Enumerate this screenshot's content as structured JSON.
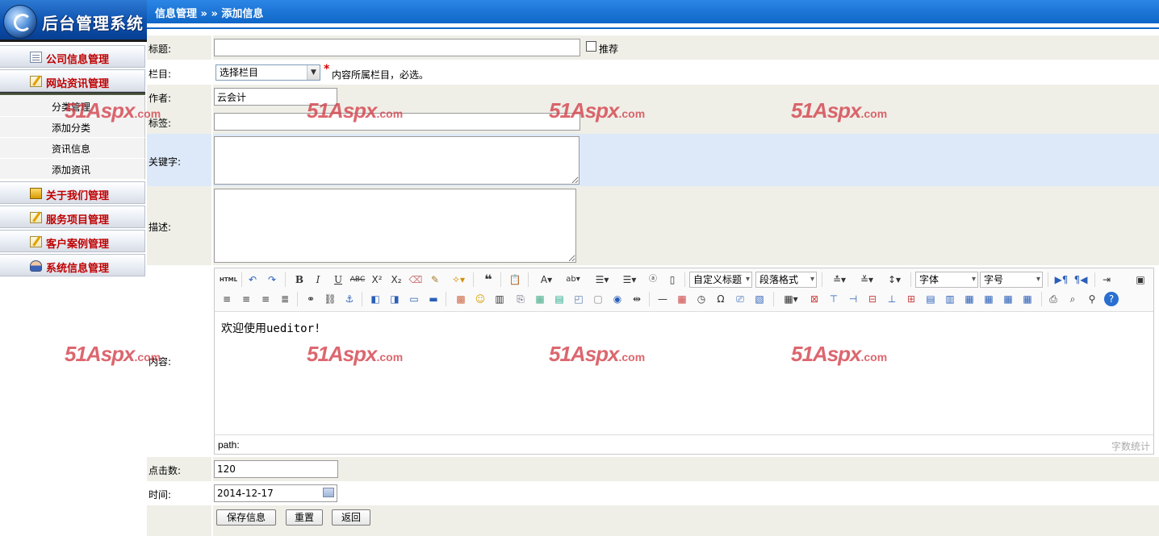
{
  "app": {
    "title": "后台管理系统",
    "breadcrumb": "信息管理 » » 添加信息"
  },
  "sidebar": {
    "menus": [
      {
        "label": "公司信息管理",
        "icon": "document-icon"
      },
      {
        "label": "网站资讯管理",
        "icon": "pencil-document-icon"
      },
      {
        "label": "关于我们管理",
        "icon": "box-icon"
      },
      {
        "label": "服务项目管理",
        "icon": "pencil-document-icon"
      },
      {
        "label": "客户案例管理",
        "icon": "pencil-document-icon"
      },
      {
        "label": "系统信息管理",
        "icon": "user-icon"
      }
    ],
    "submenu": [
      "分类管理",
      "添加分类",
      "资讯信息",
      "添加资讯"
    ]
  },
  "form": {
    "title_label": "标题:",
    "title_value": "",
    "recommend_label": "推荐",
    "column_label": "栏目:",
    "column_value": "选择栏目",
    "column_required": "*",
    "column_hint": "内容所属栏目，必选。",
    "author_label": "作者:",
    "author_value": "云会计",
    "tags_label": "标签:",
    "tags_value": "",
    "keywords_label": "关键字:",
    "keywords_value": "",
    "description_label": "描述:",
    "description_value": "",
    "content_label": "内容:",
    "clicks_label": "点击数:",
    "clicks_value": "120",
    "time_label": "时间:",
    "time_value": "2014-12-17"
  },
  "editor": {
    "content": "欢迎使用ueditor!",
    "path_label": "path:",
    "word_count": "字数统计",
    "selects": {
      "custom_title": "自定义标题",
      "paragraph": "段落格式",
      "font": "字体",
      "font_size": "字号"
    }
  },
  "buttons": {
    "save": "保存信息",
    "reset": "重置",
    "back": "返回"
  },
  "watermark": {
    "brand": "51Aspx",
    "domain": ".com"
  }
}
